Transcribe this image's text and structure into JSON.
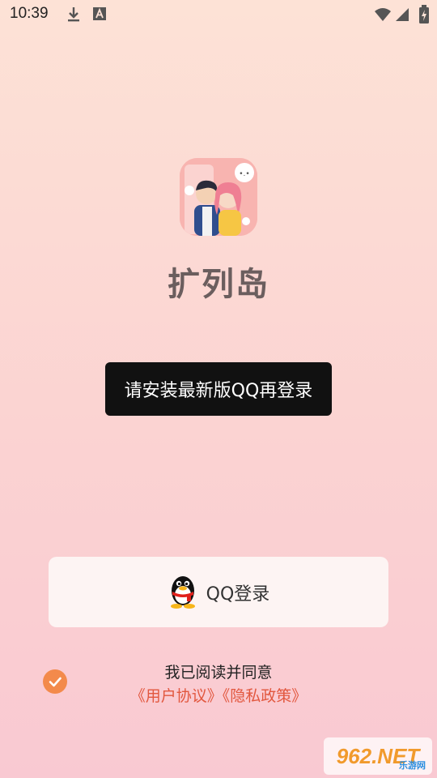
{
  "status_bar": {
    "time": "10:39"
  },
  "app": {
    "name": "扩列岛"
  },
  "toast": {
    "text": "请安装最新版QQ再登录"
  },
  "login": {
    "qq_button_label": "QQ登录"
  },
  "agreement": {
    "checked": true,
    "prefix_text": "我已阅读并同意",
    "user_agreement_link": "《用户协议》",
    "privacy_policy_link": "《隐私政策》"
  },
  "watermark": {
    "text": "962.NET",
    "sub": "乐游网"
  },
  "colors": {
    "accent": "#f38a4b",
    "link": "#e2573e",
    "toast_bg": "#111111"
  }
}
